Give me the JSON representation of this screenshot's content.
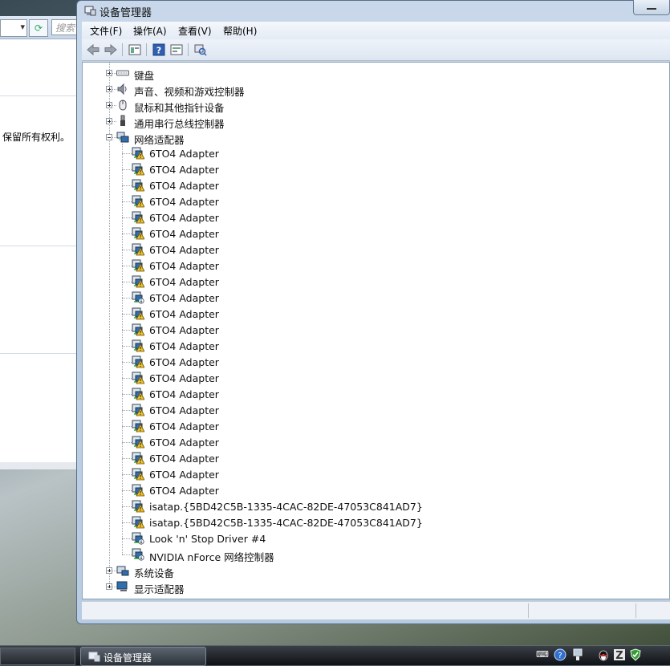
{
  "bg_window": {
    "search_placeholder": "搜索",
    "rights_text": "保留所有权利。"
  },
  "window": {
    "title": "设备管理器"
  },
  "menu": [
    "文件(F)",
    "操作(A)",
    "查看(V)",
    "帮助(H)"
  ],
  "toolbar": {
    "icons": [
      "back-arrow-icon",
      "forward-arrow-icon",
      "properties-icon",
      "help-icon",
      "show-hidden-icon",
      "scan-hardware-icon"
    ]
  },
  "tree": {
    "categories_top": [
      {
        "label": "键盘",
        "icon": "keyboard-icon"
      },
      {
        "label": "声音、视频和游戏控制器",
        "icon": "speaker-icon"
      },
      {
        "label": "鼠标和其他指针设备",
        "icon": "mouse-icon"
      },
      {
        "label": "通用串行总线控制器",
        "icon": "usb-icon"
      }
    ],
    "expanded": {
      "label": "网络适配器",
      "icon": "network-adapter-icon"
    },
    "adapters": [
      {
        "label": "6TO4 Adapter",
        "warn": true
      },
      {
        "label": "6TO4 Adapter",
        "warn": true
      },
      {
        "label": "6TO4 Adapter",
        "warn": true
      },
      {
        "label": "6TO4 Adapter",
        "warn": true
      },
      {
        "label": "6TO4 Adapter",
        "warn": true
      },
      {
        "label": "6TO4 Adapter",
        "warn": true
      },
      {
        "label": "6TO4 Adapter",
        "warn": true
      },
      {
        "label": "6TO4 Adapter",
        "warn": true
      },
      {
        "label": "6TO4 Adapter",
        "warn": true
      },
      {
        "label": "6TO4 Adapter",
        "warn": false
      },
      {
        "label": "6TO4 Adapter",
        "warn": true
      },
      {
        "label": "6TO4 Adapter",
        "warn": true
      },
      {
        "label": "6TO4 Adapter",
        "warn": true
      },
      {
        "label": "6TO4 Adapter",
        "warn": true
      },
      {
        "label": "6TO4 Adapter",
        "warn": true
      },
      {
        "label": "6TO4 Adapter",
        "warn": true
      },
      {
        "label": "6TO4 Adapter",
        "warn": true
      },
      {
        "label": "6TO4 Adapter",
        "warn": true
      },
      {
        "label": "6TO4 Adapter",
        "warn": true
      },
      {
        "label": "6TO4 Adapter",
        "warn": true
      },
      {
        "label": "6TO4 Adapter",
        "warn": true
      },
      {
        "label": "6TO4 Adapter",
        "warn": true
      },
      {
        "label": "isatap.{5BD42C5B-1335-4CAC-82DE-47053C841AD7}",
        "warn": true
      },
      {
        "label": "isatap.{5BD42C5B-1335-4CAC-82DE-47053C841AD7}",
        "warn": true
      },
      {
        "label": "Look 'n' Stop Driver #4",
        "warn": false
      },
      {
        "label": "NVIDIA nForce 网络控制器",
        "warn": false
      }
    ],
    "categories_bottom": [
      {
        "label": "系统设备",
        "icon": "system-device-icon"
      },
      {
        "label": "显示适配器",
        "icon": "display-adapter-icon"
      }
    ]
  },
  "taskbar": {
    "active_label": "设备管理器",
    "tray_icons": [
      "keyboard-icon",
      "help-circle-icon",
      "network-icon",
      "qq-penguin-icon",
      "zone-alarm-icon",
      "shield-check-icon"
    ]
  },
  "colors": {
    "accent": "#3a6fb0",
    "warning": "#f2c12e"
  }
}
